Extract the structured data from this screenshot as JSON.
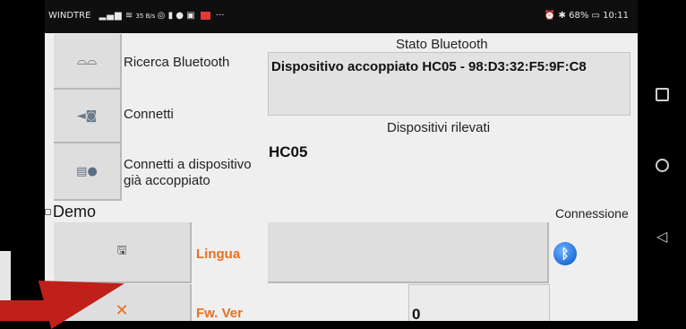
{
  "statusbar": {
    "carrier": "WINDTRE",
    "speed_top": "35",
    "speed_unit": "B/s",
    "extra": "···",
    "battery": "68%",
    "time": "10:11",
    "colors": {
      "background": "#0f0f0f",
      "text": "#e8e8e8"
    }
  },
  "buttons": {
    "search_label": "Ricerca Bluetooth",
    "search_icon": "binoculars-icon",
    "connect_label": "Connetti",
    "connect_icon": "plug-icon",
    "paired_label_line1": "Connetti a dispositivo",
    "paired_label_line2": "già accoppiato",
    "paired_icon": "bluetooth-device-icon",
    "save_icon": "floppy-disk-icon",
    "close_icon": "close-icon"
  },
  "bluetooth": {
    "status_title": "Stato Bluetooth",
    "status_value": "Dispositivo accoppiato HC05 - 98:D3:32:F5:9F:C8",
    "detected_title": "Dispositivi rilevati",
    "detected_device": "HC05"
  },
  "demo": {
    "label": "Demo"
  },
  "connection": {
    "label": "Connessione"
  },
  "language": {
    "label": "Lingua"
  },
  "firmware": {
    "label": "Fw. Ver",
    "value": "0"
  },
  "colors": {
    "accent_orange": "#e8701f",
    "bluetooth_blue": "#1e6fd9"
  }
}
